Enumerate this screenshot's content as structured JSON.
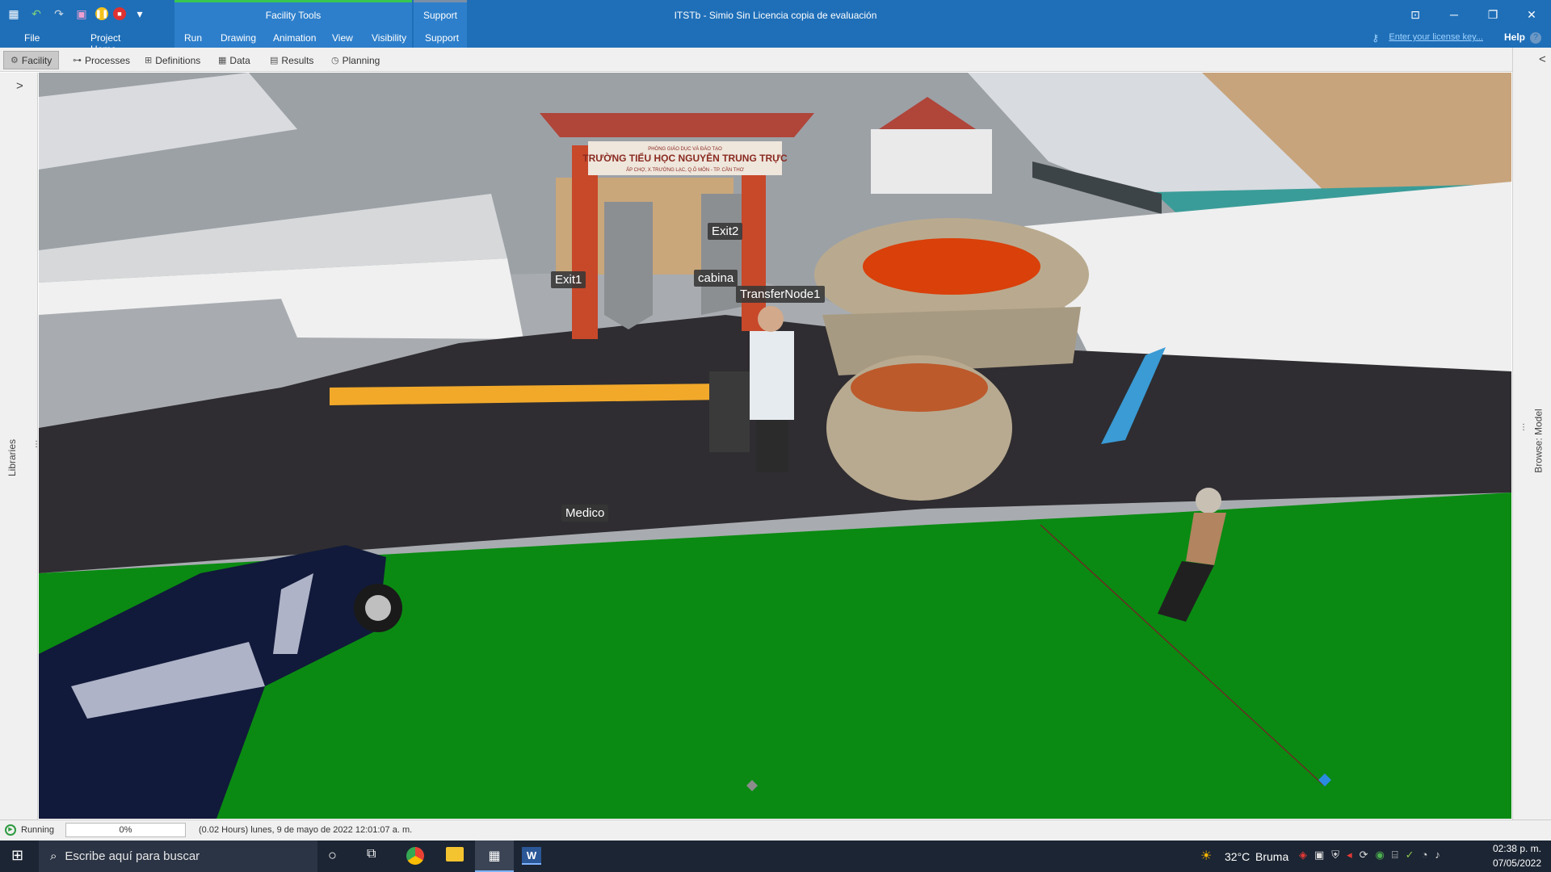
{
  "window": {
    "app_title": "ITSTb - Simio Sin Licencia copia de evaluación",
    "context_groups": {
      "facility_tools": "Facility Tools",
      "support": "Support"
    },
    "ribbon_tabs": [
      "File",
      "Project Home",
      "Run",
      "Drawing",
      "Animation",
      "View",
      "Visibility",
      "Support"
    ],
    "license_link": "Enter your license key...",
    "help": "Help",
    "help_q": "?",
    "controls": {
      "ribbon": "⊡",
      "minimize": "─",
      "restore": "❐",
      "close": "✕"
    }
  },
  "quick_access": {
    "dropdown": "▾"
  },
  "view_tabs": [
    "Facility",
    "Processes",
    "Definitions",
    "Data",
    "Results",
    "Planning"
  ],
  "left_panel": {
    "expand": ">",
    "label": "Libraries"
  },
  "right_panel": {
    "collapse": "<",
    "label": "Browse: Model"
  },
  "scene_labels": {
    "exit2": "Exit2",
    "exit1": "Exit1",
    "cabina": "cabina",
    "transfer": "TransferNode1",
    "medico": "Medico"
  },
  "gate_sign": {
    "top": "PHÒNG GIÁO DỤC VÀ ĐÀO TẠO",
    "main": "TRƯỜNG TIỂU HỌC NGUYỄN TRUNG TRỰC",
    "sub": "ẤP CHỢ, X.TRƯỜNG LẠC, Q.Ô MÔN - TP. CẦN THƠ"
  },
  "status": {
    "state": "Running",
    "progress_text": "0%",
    "progress": 0,
    "sim_time": "(0.02 Hours) lunes, 9 de mayo de 2022 12:01:07 a. m."
  },
  "taskbar": {
    "search_placeholder": "Escribe aquí para buscar",
    "weather_temp": "32°C",
    "weather_text": "Bruma",
    "time": "02:38 p. m.",
    "date": "07/05/2022"
  },
  "colors": {
    "accent": "#1f6fb8",
    "grass": "#0a8a12",
    "road": "#2f2d31"
  }
}
